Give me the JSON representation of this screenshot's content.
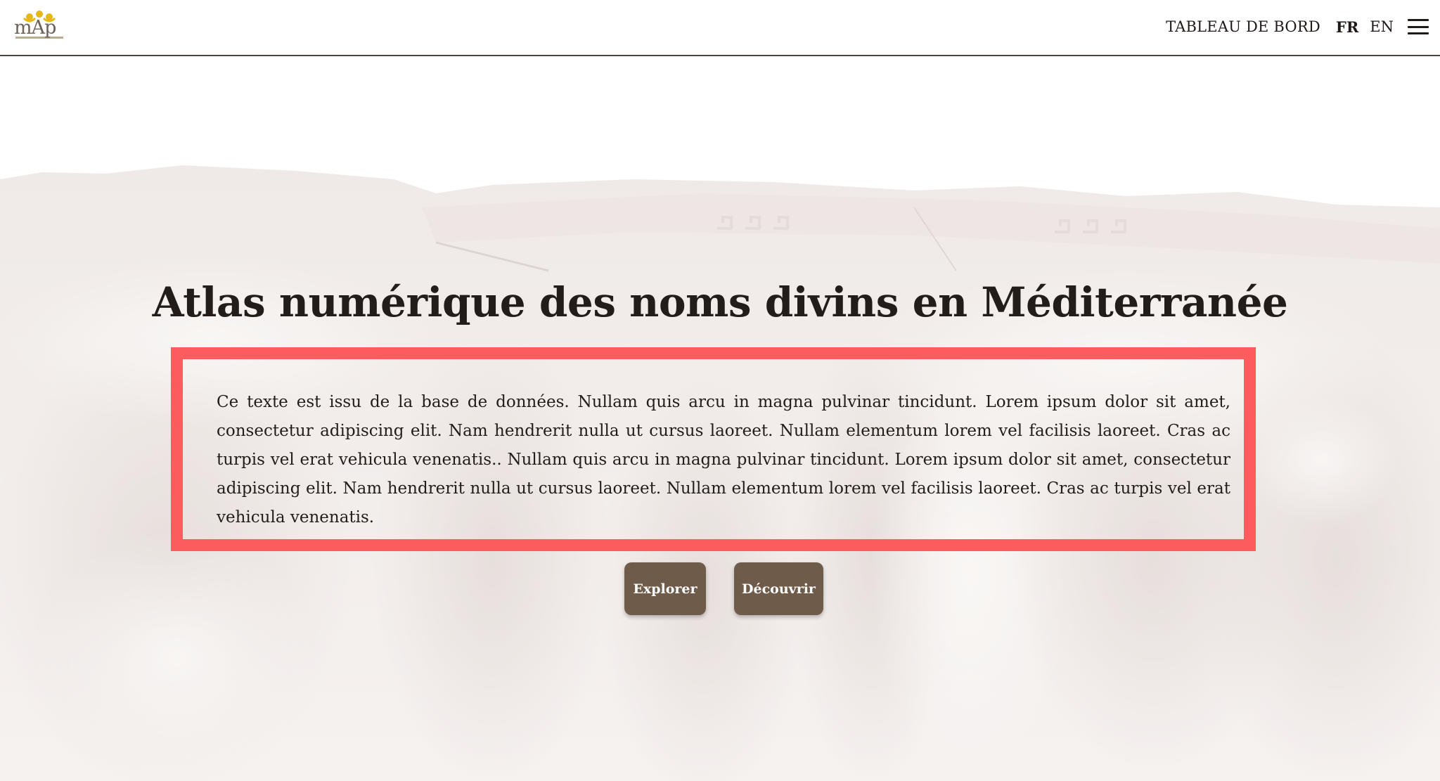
{
  "header": {
    "logo_text": "mAp",
    "nav": {
      "dashboard_label": "TABLEAU DE BORD",
      "languages": [
        "FR",
        "EN"
      ],
      "active_language": "FR"
    }
  },
  "hero": {
    "title": "Atlas numérique des noms divins en Méditerranée",
    "intro_text": "Ce texte est issu de la base de données. Nullam quis arcu in magna pulvinar tincidunt. Lorem ipsum dolor sit amet, consectetur adipiscing elit. Nam hendrerit nulla ut cursus laoreet. Nullam elementum lorem vel facilisis laoreet. Cras ac turpis vel erat vehicula venenatis.. Nullam quis arcu in magna pulvinar tincidunt. Lorem ipsum dolor sit amet, consectetur adipiscing elit. Nam hendrerit nulla ut cursus laoreet. Nullam elementum lorem vel facilisis laoreet. Cras ac turpis vel erat vehicula venenatis.",
    "buttons": {
      "explorer_label": "Explorer",
      "discover_label": "Découvrir"
    }
  },
  "colors": {
    "header_border": "#4d463f",
    "button_bg": "#6e5b4a",
    "highlight_border": "#fd5c5f",
    "text": "#231d19"
  },
  "icons": {
    "menu": "hamburger-menu-icon",
    "logo": "map-logo"
  }
}
